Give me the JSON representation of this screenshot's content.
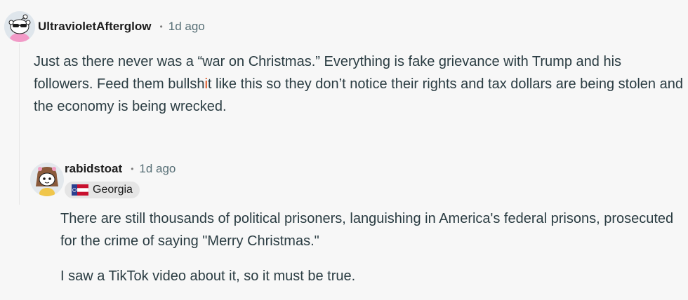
{
  "comments": [
    {
      "username": "UltravioletAfterglow",
      "separator": "•",
      "time": "1d ago",
      "avatar_icon": "snoo-sunglasses-avatar-icon",
      "body": {
        "before_censor": "Just as there never was a “war on Christmas.” Everything is fake grievance with Trump and his followers. Feed them bullsh",
        "censor_char": "i",
        "after_censor": "t like this so they don’t notice their rights and tax dollars are being stolen and the economy is being wrecked."
      }
    },
    {
      "username": "rabidstoat",
      "separator": "•",
      "time": "1d ago",
      "avatar_icon": "snoo-girl-avatar-icon",
      "flair": {
        "label": "Georgia",
        "icon": "georgia-flag-icon"
      },
      "paragraphs": [
        "There are still thousands of political prisoners, languishing in America's federal prisons, prosecuted for the crime of saying \"Merry Christmas.\"",
        "I saw a TikTok video about it, so it must be true."
      ]
    }
  ],
  "colors": {
    "background": "#f7f7f7",
    "username": "#1c1c1c",
    "meta": "#576f76",
    "body_text": "#2a3c42",
    "censor_accent": "#d93a00",
    "flair_bg": "#e5e5e5"
  }
}
